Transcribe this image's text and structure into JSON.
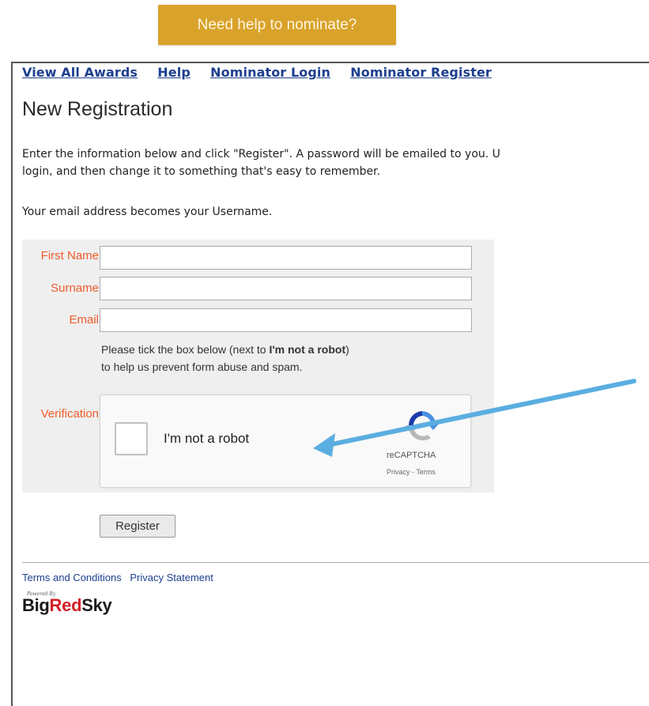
{
  "help_button": {
    "label": "Need help to nominate?"
  },
  "nav": {
    "items": [
      "View All Awards",
      "Help",
      "Nominator Login",
      "Nominator Register"
    ]
  },
  "page_title": "New Registration",
  "intro": {
    "line1": "Enter the information below and click \"Register\". A password will be emailed to you. U",
    "line2": "login, and then change it to something that's easy to remember.",
    "line3": "Your email address becomes your Username."
  },
  "form": {
    "first_name_label": "First Name",
    "surname_label": "Surname",
    "email_label": "Email",
    "first_name_value": "",
    "surname_value": "",
    "email_value": "",
    "note_line1_prefix": "Please tick the box below (next to ",
    "note_line1_bold": "I'm not a robot",
    "note_line1_suffix": ")",
    "note_line2": "to help us prevent form abuse and spam.",
    "verification_label": "Verification"
  },
  "captcha": {
    "checkbox_label": "I'm not a robot",
    "brand": "reCAPTCHA",
    "links": "Privacy - Terms"
  },
  "register_button": {
    "label": "Register"
  },
  "footer": {
    "terms": "Terms and Conditions",
    "privacy": "Privacy Statement",
    "powered_by": "Powered By",
    "brand_part1": "Big",
    "brand_part2": "Red",
    "brand_part3": "Sky"
  },
  "colors": {
    "help_button_bg": "#d9a22a",
    "link_blue": "#1d3f8e",
    "label_orange": "#f05a2a",
    "brand_red": "#d21f26",
    "arrow_blue": "#5aaee0"
  }
}
